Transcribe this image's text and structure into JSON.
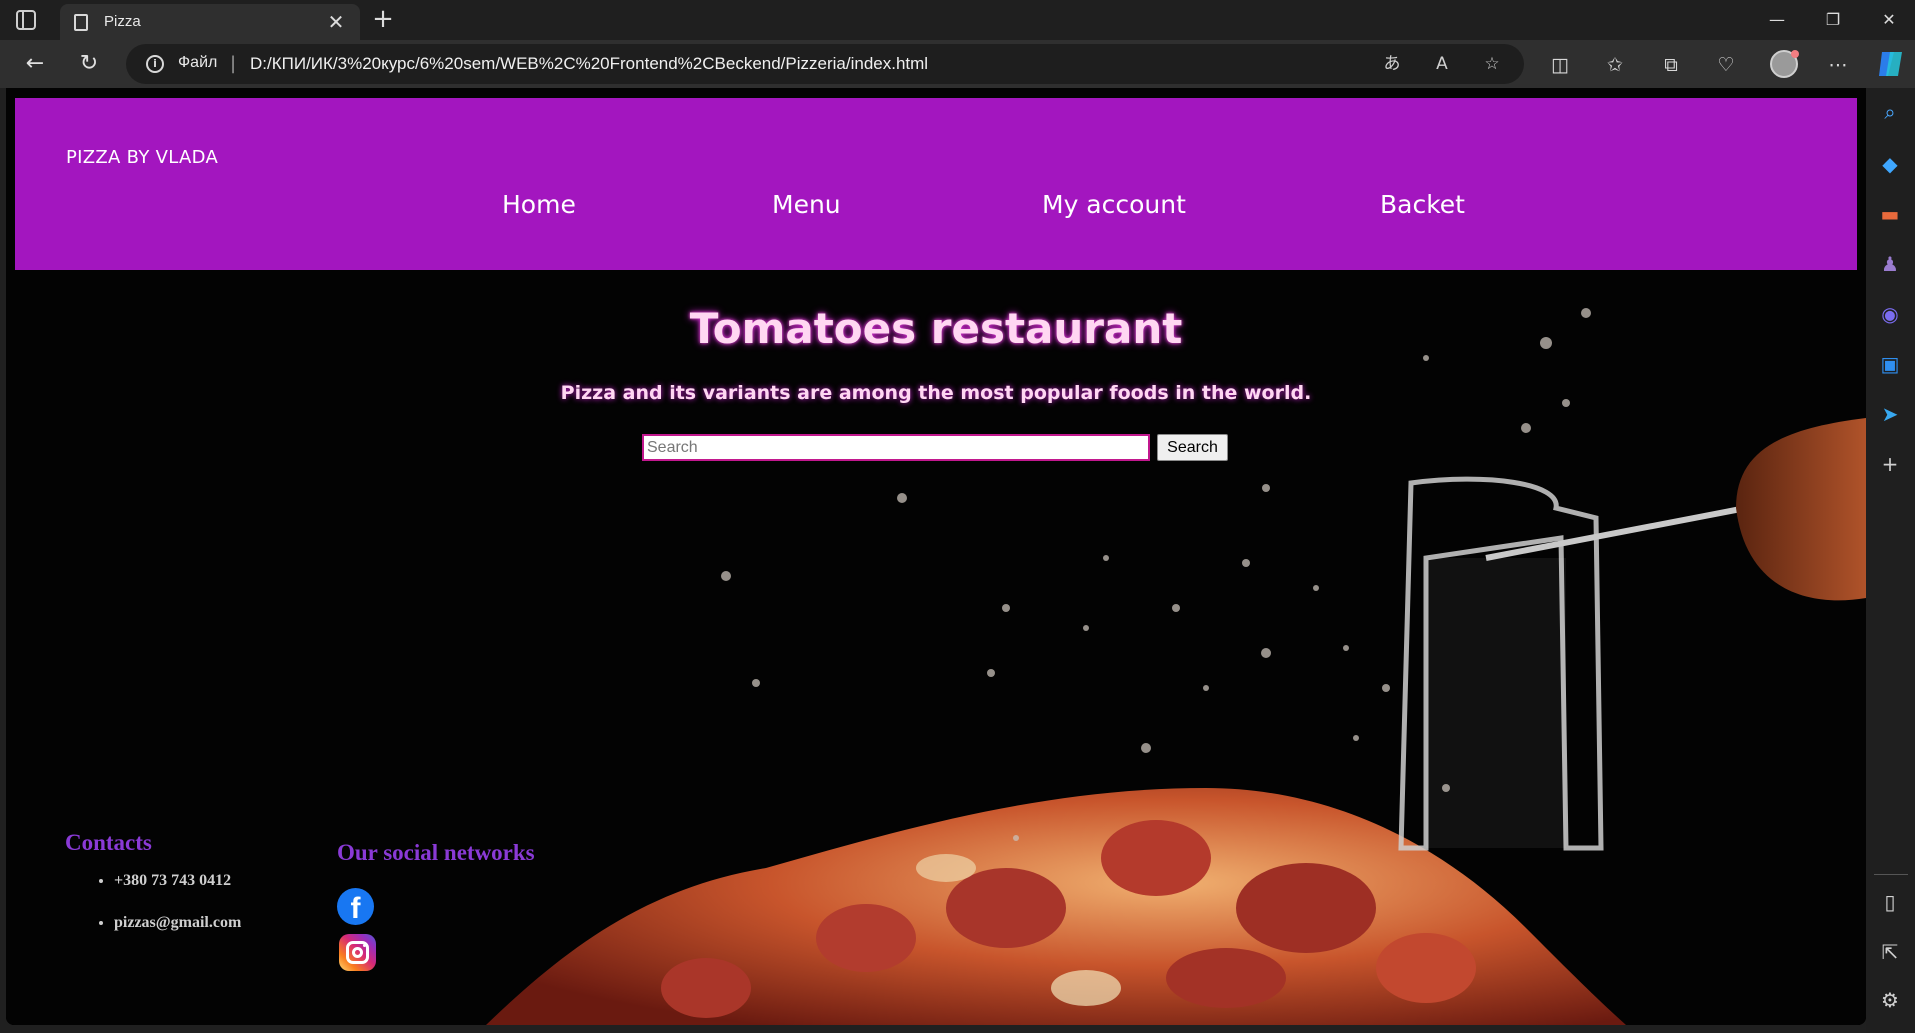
{
  "browser": {
    "tab_title": "Pizza",
    "address_scheme": "Файл",
    "address_url": "D:/КПИ/ИК/3%20курс/6%20sem/WEB%2C%20Frontend%2CBeckend/Pizzeria/index.html",
    "icons": {
      "tab_actions": "tab-actions-icon",
      "page": "page-icon",
      "close_tab": "close-icon",
      "new_tab": "plus-icon",
      "minimize": "minimize-icon",
      "restore": "restore-icon",
      "close_window": "close-icon",
      "back": "back-arrow-icon",
      "refresh": "refresh-icon",
      "site_info": "info-icon",
      "translate": "translate-icon",
      "read_aloud": "read-aloud-icon",
      "favorite": "star-icon",
      "split_screen": "split-screen-icon",
      "favorites": "favorites-icon",
      "collections": "collections-icon",
      "browser_essentials": "heart-pulse-icon",
      "profile": "avatar-icon",
      "more": "ellipsis-icon",
      "copilot": "copilot-icon"
    }
  },
  "edge_sidebar": {
    "icons": [
      "search-icon",
      "shopping-tag-icon",
      "toolbox-icon",
      "games-icon",
      "copilot-icon",
      "outlook-icon",
      "send-icon",
      "plus-icon",
      "sidebar-toggle-icon",
      "open-external-icon",
      "settings-icon"
    ]
  },
  "site": {
    "brand": "PIZZA BY VLADA",
    "nav": [
      "Home",
      "Menu",
      "My account",
      "Backet"
    ],
    "hero_title": "Tomatoes restaurant",
    "hero_subtitle": "Pizza and its variants are among the most popular foods in the world.",
    "search": {
      "placeholder": "Search",
      "value": "",
      "button_label": "Search"
    },
    "contacts": {
      "title": "Contacts",
      "items": [
        "+380 73 743 0412",
        "pizzas@gmail.com"
      ]
    },
    "social": {
      "title": "Our social networks",
      "icons": [
        "facebook-icon",
        "instagram-icon"
      ]
    }
  },
  "colors": {
    "header_bg": "#a316bf",
    "section_heading": "#8a3ad6",
    "hero_text": "#ffd7f2",
    "search_border": "#c2188e"
  }
}
